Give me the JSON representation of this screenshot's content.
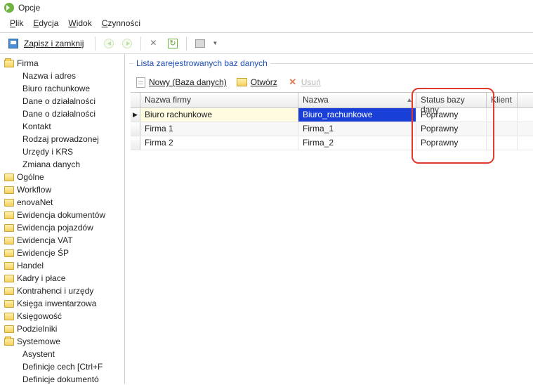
{
  "window": {
    "title": "Opcje"
  },
  "menu": {
    "file": "Plik",
    "edit": "Edycja",
    "view": "Widok",
    "actions": "Czynności"
  },
  "toolbar": {
    "save_close": "Zapisz i zamknij"
  },
  "tree": {
    "firma": {
      "label": "Firma",
      "children": [
        "Nazwa i adres",
        "Biuro rachunkowe",
        "Dane o działalności",
        "Dane o działalności",
        "Kontakt",
        "Rodzaj prowadzonej",
        "Urzędy i KRS",
        "Zmiana danych"
      ]
    },
    "others": [
      "Ogólne",
      "Workflow",
      "enovaNet",
      "Ewidencja dokumentów",
      "Ewidencja pojazdów",
      "Ewidencja VAT",
      "Ewidencje ŚP",
      "Handel",
      "Kadry i płace",
      "Kontrahenci i urzędy",
      "Księga inwentarzowa",
      "Księgowość",
      "Podzielniki"
    ],
    "systemowe": {
      "label": "Systemowe",
      "children": [
        "Asystent",
        "Definicje cech [Ctrl+F",
        "Definicje dokumentó"
      ]
    }
  },
  "panel": {
    "title": "Lista zarejestrowanych baz danych",
    "new": "Nowy (Baza danych)",
    "open": "Otwórz",
    "delete": "Usuń"
  },
  "grid": {
    "headers": {
      "c1": "Nazwa firmy",
      "c2": "Nazwa",
      "c3": "Status bazy dany",
      "c4": "Klient"
    },
    "rows": [
      {
        "c1": "Biuro rachunkowe",
        "c2": "Biuro_rachunkowe",
        "c3": "Poprawny",
        "c4": ""
      },
      {
        "c1": "Firma 1",
        "c2": "Firma_1",
        "c3": "Poprawny",
        "c4": ""
      },
      {
        "c1": "Firma 2",
        "c2": "Firma_2",
        "c3": "Poprawny",
        "c4": ""
      }
    ]
  }
}
